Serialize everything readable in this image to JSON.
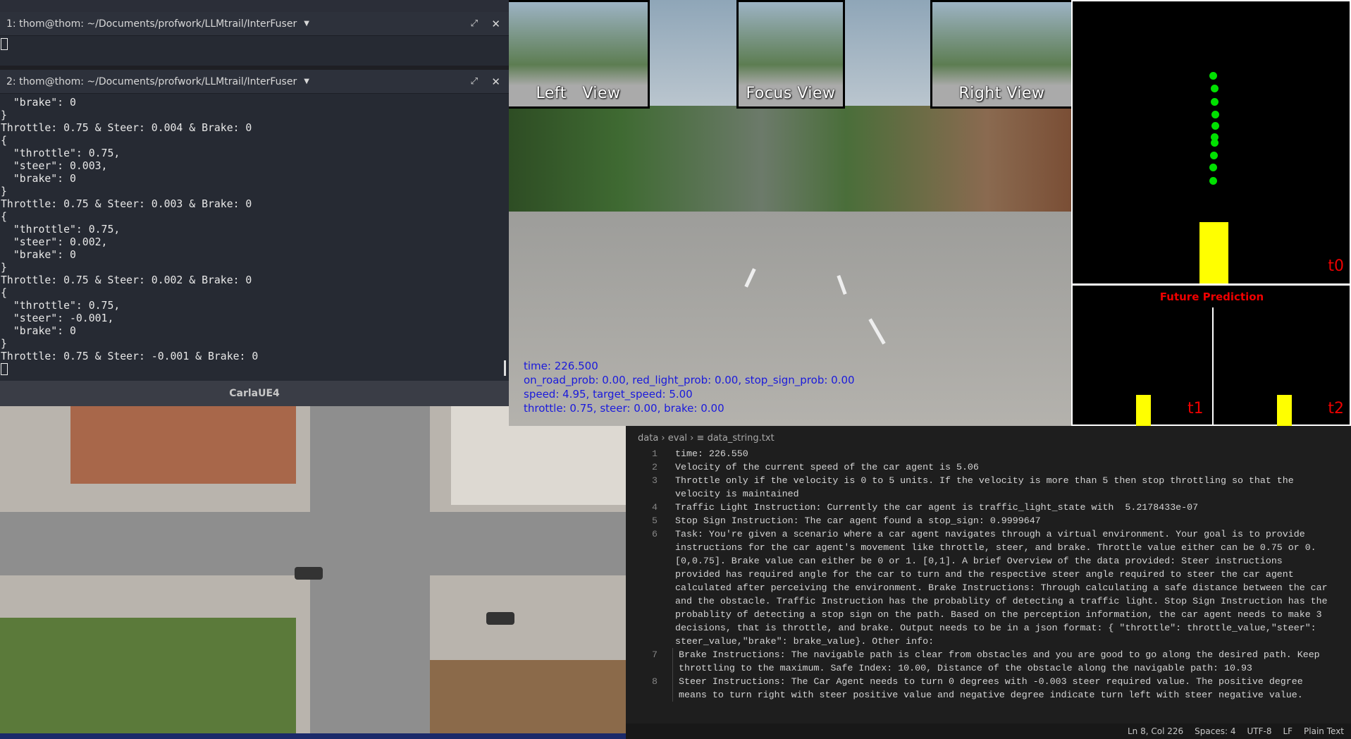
{
  "terminal": {
    "pane1": {
      "title": "1: thom@thom: ~/Documents/profwork/LLMtrail/InterFuser"
    },
    "pane2": {
      "title": "2: thom@thom: ~/Documents/profwork/LLMtrail/InterFuser",
      "lines": [
        "  \"brake\": 0",
        "}",
        "Throttle: 0.75 & Steer: 0.004 & Brake: 0",
        "{",
        "  \"throttle\": 0.75,",
        "  \"steer\": 0.003,",
        "  \"brake\": 0",
        "}",
        "Throttle: 0.75 & Steer: 0.003 & Brake: 0",
        "{",
        "  \"throttle\": 0.75,",
        "  \"steer\": 0.002,",
        "  \"brake\": 0",
        "}",
        "Throttle: 0.75 & Steer: 0.002 & Brake: 0",
        "{",
        "  \"throttle\": 0.75,",
        "  \"steer\": -0.001,",
        "  \"brake\": 0",
        "}",
        "Throttle: 0.75 & Steer: -0.001 & Brake: 0"
      ]
    }
  },
  "carla_window": {
    "title": "CarlaUE4"
  },
  "camera": {
    "views": [
      "Left   View",
      "Focus View",
      "Right View"
    ],
    "overlay": [
      "time: 226.500",
      "on_road_prob: 0.00, red_light_prob: 0.00, stop_sign_prob: 0.00",
      "speed: 4.95, target_speed: 5.00",
      "throttle: 0.75, steer: 0.00, brake: 0.00"
    ],
    "overlay_color": "#1a1adc"
  },
  "prediction": {
    "t0": "t0",
    "title": "Future Prediction",
    "t1": "t1",
    "t2": "t2",
    "waypoint_color": "#00e000",
    "vehicle_color": "#ffff00",
    "label_color": "#e00000"
  },
  "editor": {
    "breadcrumb": [
      "data",
      "eval",
      "data_string.txt"
    ],
    "lines": [
      {
        "n": "1",
        "t": "time: 226.550"
      },
      {
        "n": "2",
        "t": "Velocity of the current speed of the car agent is 5.06"
      },
      {
        "n": "3",
        "t": "Throttle only if the velocity is 0 to 5 units. If the velocity is more than 5 then stop throttling so that the velocity is maintained"
      },
      {
        "n": "4",
        "t": "Traffic Light Instruction: Currently the car agent is traffic_light_state with  5.2178433e-07"
      },
      {
        "n": "5",
        "t": "Stop Sign Instruction: The car agent found a stop_sign: 0.9999647"
      },
      {
        "n": "6",
        "t": "Task: You're given a scenario where a car agent navigates through a virtual environment. Your goal is to provide instructions for the car agent's movement like throttle, steer, and brake. Throttle value either can be 0.75 or 0. [0,0.75]. Brake value can either be 0 or 1. [0,1]. A brief Overview of the data provided: Steer instructions provided has required angle for the car to turn and the respective steer angle required to steer the car agent calculated after perceiving the environment. Brake Instructions: Through calculating a safe distance between the car and the obstacle. Traffic Instruction has the probablity of detecting a traffic light. Stop Sign Instruction has the probablity of detecting a stop sign on the path. Based on the perception information, the car agent needs to make 3 decisions, that is throttle, and brake. Output needs to be in a json format: { \"throttle\": throttle_value,\"steer\": steer_value,\"brake\": brake_value}. Other info:"
      },
      {
        "n": "7",
        "t": "Brake Instructions: The navigable path is clear from obstacles and you are good to go along the desired path. Keep throttling to the maximum. Safe Index: 10.00, Distance of the obstacle along the navigable path: 10.93"
      },
      {
        "n": "8",
        "t": "Steer Instructions: The Car Agent needs to turn 0 degrees with -0.003 steer required value. The positive degree means to turn right with steer positive value and negative degree indicate turn left with steer negative value."
      }
    ],
    "status": [
      "Ln 8, Col 226",
      "Spaces: 4",
      "UTF-8",
      "LF",
      "Plain Text"
    ]
  }
}
